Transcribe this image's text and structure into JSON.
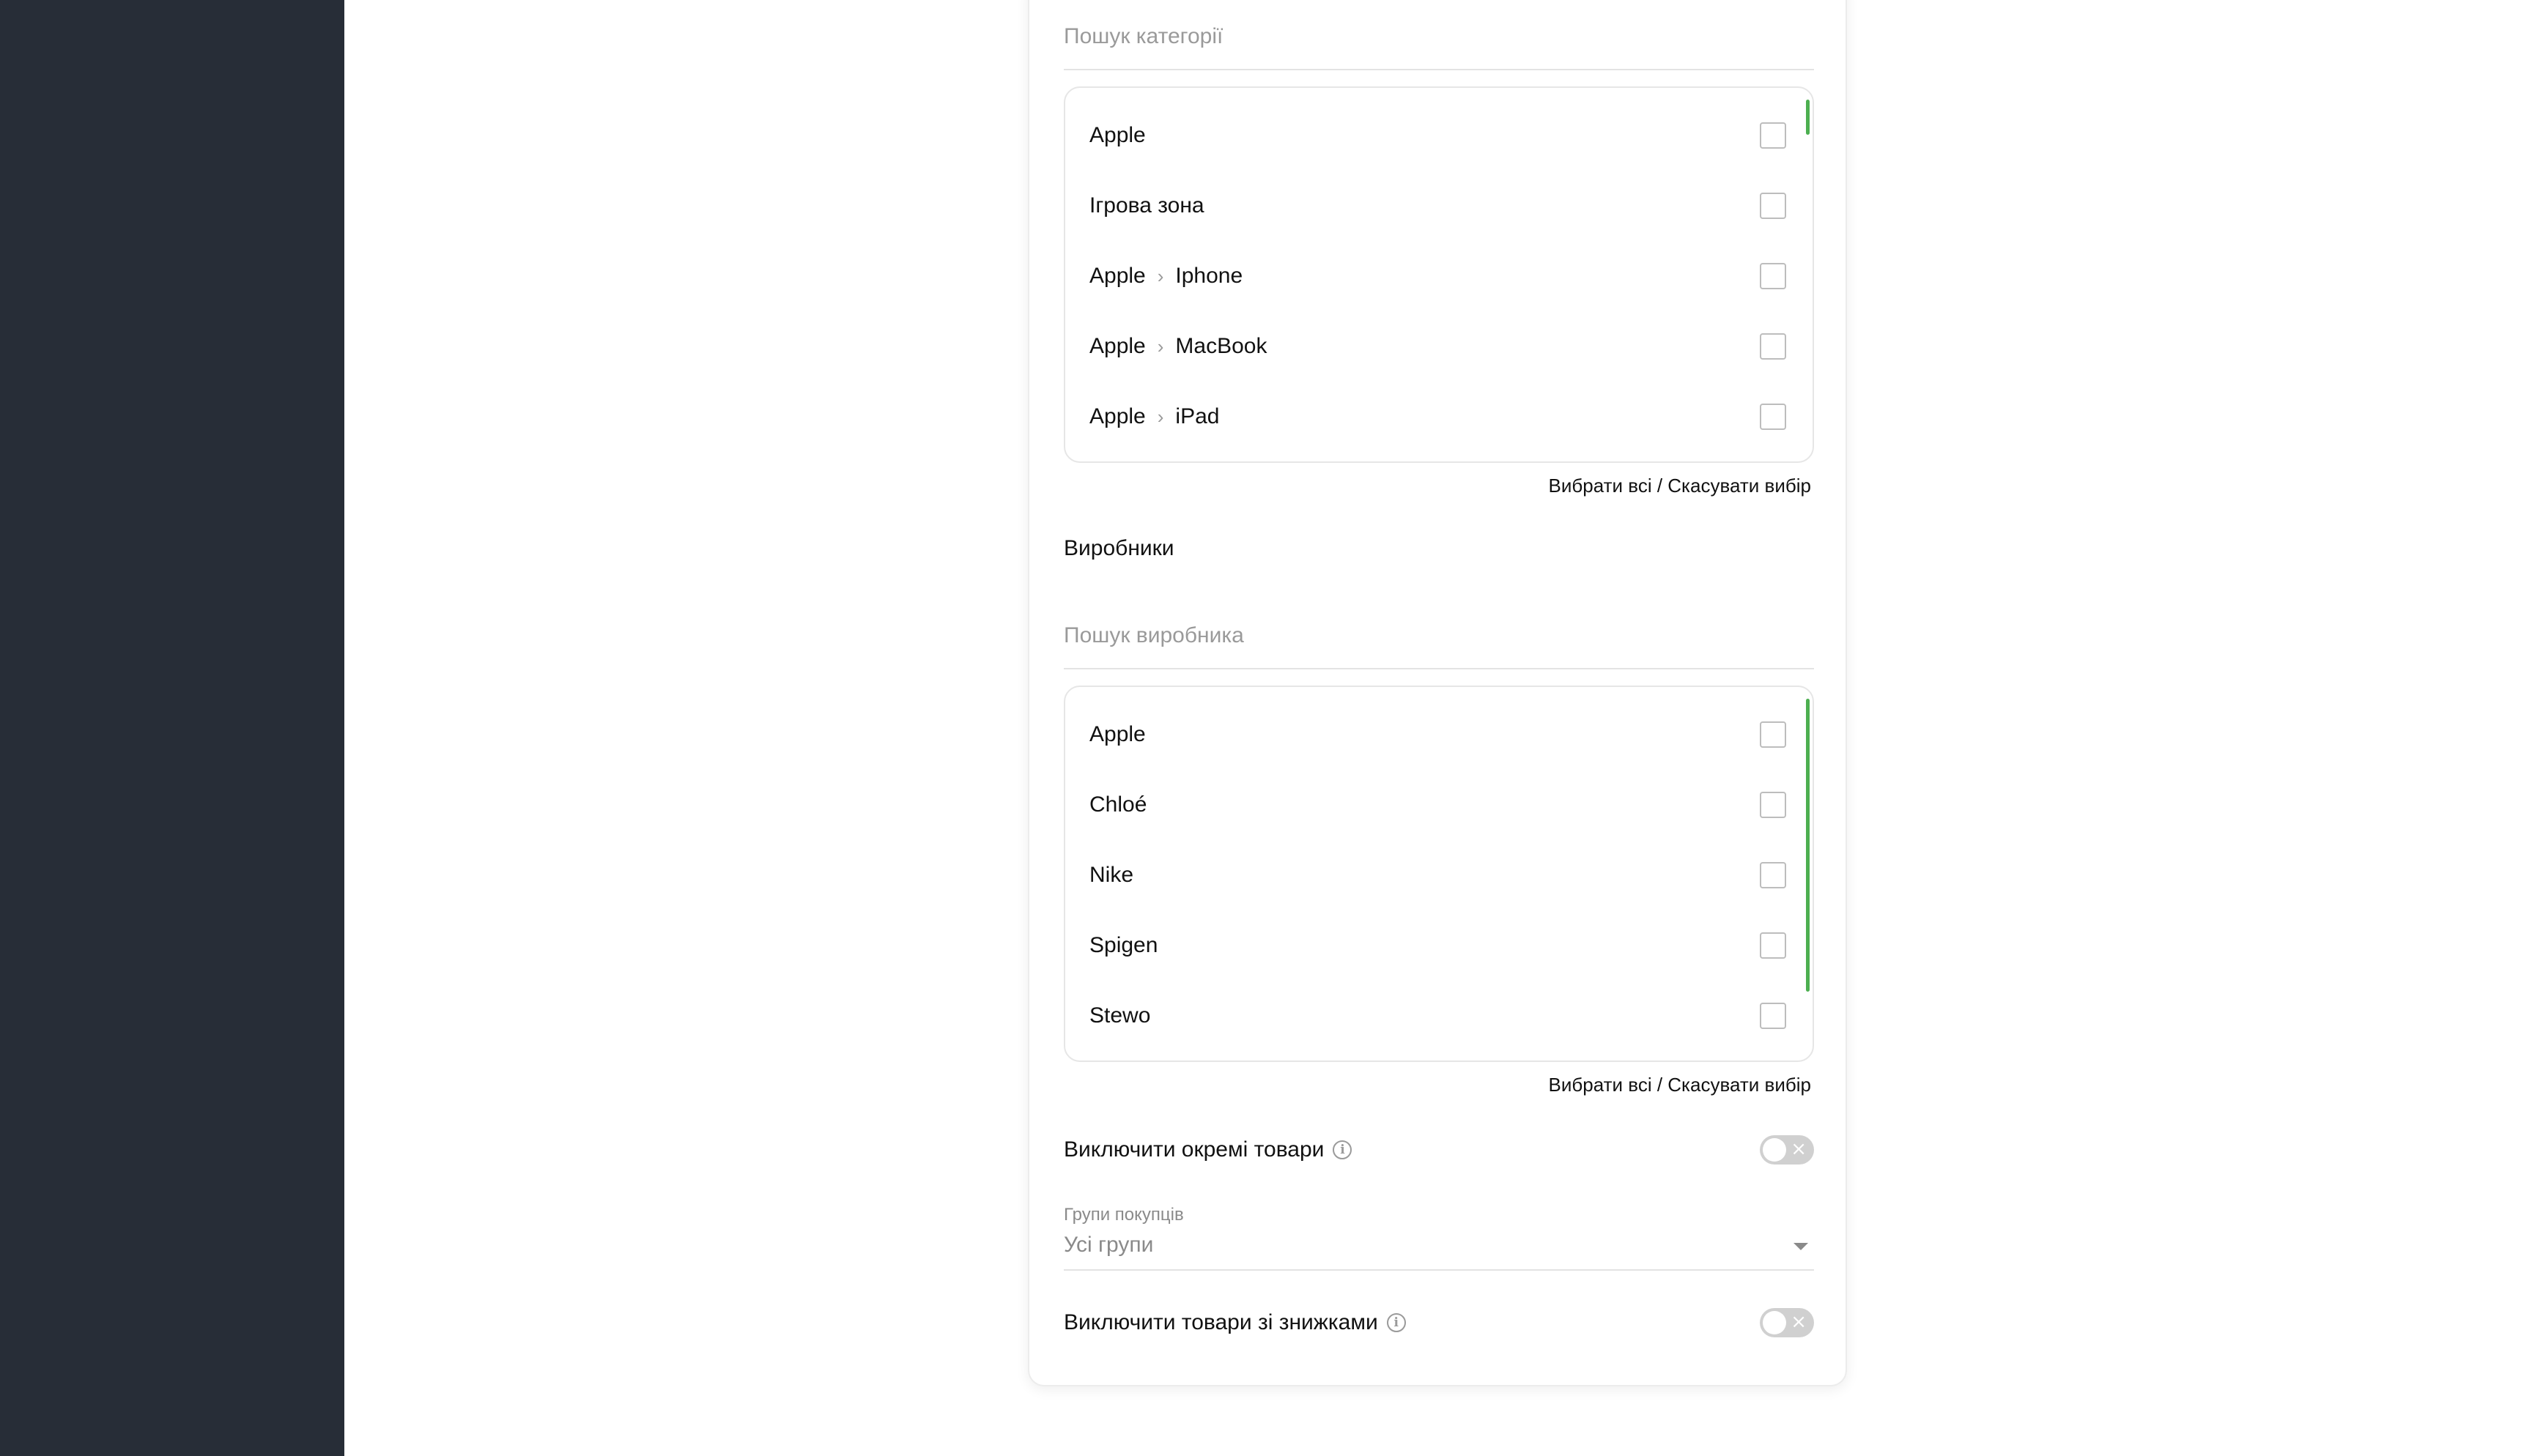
{
  "categories": {
    "search_placeholder": "Пошук категорії",
    "items": [
      {
        "parts": [
          "Apple"
        ]
      },
      {
        "parts": [
          "Ігрова зона"
        ]
      },
      {
        "parts": [
          "Apple",
          "Iphone"
        ]
      },
      {
        "parts": [
          "Apple",
          "MacBook"
        ]
      },
      {
        "parts": [
          "Apple",
          "iPad"
        ]
      }
    ],
    "select_all": "Вибрати всі / Скасувати вибір"
  },
  "manufacturers": {
    "title": "Виробники",
    "search_placeholder": "Пошук виробника",
    "items": [
      {
        "label": "Apple"
      },
      {
        "label": "Chloé"
      },
      {
        "label": "Nike"
      },
      {
        "label": "Spigen"
      },
      {
        "label": "Stewo"
      }
    ],
    "select_all": "Вибрати всі / Скасувати вибір"
  },
  "exclude_products": {
    "label": "Виключити окремі товари",
    "enabled": false
  },
  "customer_groups": {
    "label": "Групи покупців",
    "value": "Усі групи"
  },
  "exclude_discounted": {
    "label": "Виключити товари зі знижками",
    "enabled": false
  },
  "colors": {
    "accent": "#4caf50",
    "sidebar": "#272d37"
  }
}
